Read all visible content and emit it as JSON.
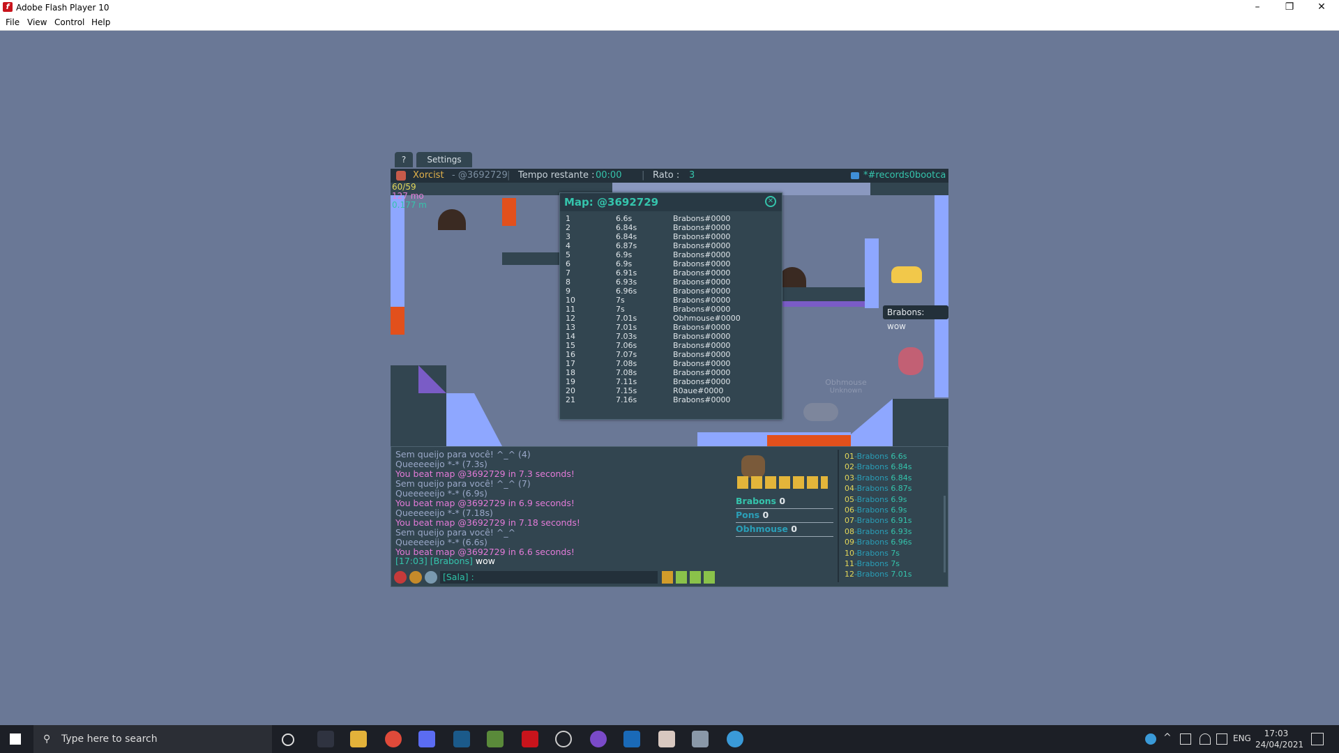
{
  "window": {
    "title": "Adobe Flash Player 10"
  },
  "menu": [
    "File",
    "View",
    "Control",
    "Help"
  ],
  "game": {
    "tabs": [
      "?",
      "Settings"
    ],
    "hud": {
      "player": "Xorcist",
      "map_code": "- @3692729",
      "time_label": "Tempo restante :",
      "time_value": "00:00",
      "rato_label": "Rato :",
      "rato_value": "3",
      "room": "*#records0bootca"
    },
    "stats": [
      "60/59",
      "127 mo",
      "0.177 m"
    ],
    "tooltip": "Brabons: wow",
    "ghost_name": "Obhmouse",
    "ghost_title": "Unknown",
    "map_window": {
      "title": "Map: @3692729",
      "records": [
        {
          "pos": "1",
          "time": "6.6s",
          "name": "Brabons#0000"
        },
        {
          "pos": "2",
          "time": "6.84s",
          "name": "Brabons#0000"
        },
        {
          "pos": "3",
          "time": "6.84s",
          "name": "Brabons#0000"
        },
        {
          "pos": "4",
          "time": "6.87s",
          "name": "Brabons#0000"
        },
        {
          "pos": "5",
          "time": "6.9s",
          "name": "Brabons#0000"
        },
        {
          "pos": "6",
          "time": "6.9s",
          "name": "Brabons#0000"
        },
        {
          "pos": "7",
          "time": "6.91s",
          "name": "Brabons#0000"
        },
        {
          "pos": "8",
          "time": "6.93s",
          "name": "Brabons#0000"
        },
        {
          "pos": "9",
          "time": "6.96s",
          "name": "Brabons#0000"
        },
        {
          "pos": "10",
          "time": "7s",
          "name": "Brabons#0000"
        },
        {
          "pos": "11",
          "time": "7s",
          "name": "Brabons#0000"
        },
        {
          "pos": "12",
          "time": "7.01s",
          "name": "Obhmouse#0000"
        },
        {
          "pos": "13",
          "time": "7.01s",
          "name": "Brabons#0000"
        },
        {
          "pos": "14",
          "time": "7.03s",
          "name": "Brabons#0000"
        },
        {
          "pos": "15",
          "time": "7.06s",
          "name": "Brabons#0000"
        },
        {
          "pos": "16",
          "time": "7.07s",
          "name": "Brabons#0000"
        },
        {
          "pos": "17",
          "time": "7.08s",
          "name": "Brabons#0000"
        },
        {
          "pos": "18",
          "time": "7.08s",
          "name": "Brabons#0000"
        },
        {
          "pos": "19",
          "time": "7.11s",
          "name": "Brabons#0000"
        },
        {
          "pos": "20",
          "time": "7.15s",
          "name": "R0aue#0000"
        },
        {
          "pos": "21",
          "time": "7.16s",
          "name": "Brabons#0000"
        }
      ]
    },
    "chat": [
      {
        "text": "Sem queijo para você! ^_^ (4)",
        "color": "#9aa8c8"
      },
      {
        "text": "Queeeeeijo *-* (7.3s)",
        "color": "#9aa8c8"
      },
      {
        "text": "You beat map @3692729 in 7.3 seconds!",
        "color": "#e37bd8"
      },
      {
        "text": "Sem queijo para você! ^_^ (7)",
        "color": "#9aa8c8"
      },
      {
        "text": "Queeeeeijo *-* (6.9s)",
        "color": "#9aa8c8"
      },
      {
        "text": "You beat map @3692729 in 6.9 seconds!",
        "color": "#e37bd8"
      },
      {
        "text": "Queeeeeijo *-* (7.18s)",
        "color": "#9aa8c8"
      },
      {
        "text": "You beat map @3692729 in 7.18 seconds!",
        "color": "#e37bd8"
      },
      {
        "text": "Sem queijo para você! ^_^",
        "color": "#9aa8c8"
      },
      {
        "text": "Queeeeeijo *-* (6.6s)",
        "color": "#9aa8c8"
      },
      {
        "text": "You beat map @3692729 in 6.6 seconds!",
        "color": "#e37bd8"
      }
    ],
    "chat_last": {
      "prefix": "[17:03] [Brabons]",
      "message": "wow"
    },
    "chat_input_prefix": "[Sala] :",
    "players": [
      {
        "name": "Brabons",
        "score": "0",
        "color": "#35c4ac"
      },
      {
        "name": "Pons",
        "score": "0",
        "color": "#2a9fb8"
      },
      {
        "name": "Obhmouse",
        "score": "0",
        "color": "#2a9fb8"
      }
    ],
    "leaderboard": [
      {
        "rank": "01",
        "name": "-Brabons",
        "time": "6.6s"
      },
      {
        "rank": "02",
        "name": "-Brabons",
        "time": "6.84s"
      },
      {
        "rank": "03",
        "name": "-Brabons",
        "time": "6.84s"
      },
      {
        "rank": "04",
        "name": "-Brabons",
        "time": "6.87s"
      },
      {
        "rank": "05",
        "name": "-Brabons",
        "time": "6.9s"
      },
      {
        "rank": "06",
        "name": "-Brabons",
        "time": "6.9s"
      },
      {
        "rank": "07",
        "name": "-Brabons",
        "time": "6.91s"
      },
      {
        "rank": "08",
        "name": "-Brabons",
        "time": "6.93s"
      },
      {
        "rank": "09",
        "name": "-Brabons",
        "time": "6.96s"
      },
      {
        "rank": "10",
        "name": "-Brabons",
        "time": "7s"
      },
      {
        "rank": "11",
        "name": "-Brabons",
        "time": "7s"
      },
      {
        "rank": "12",
        "name": "-Brabons",
        "time": "7.01s"
      }
    ],
    "colors": {
      "accent": "#35c4ac",
      "panel": "#324550",
      "bg": "#6a7896"
    }
  },
  "taskbar": {
    "search_placeholder": "Type here to search",
    "language": "ENG",
    "time": "17:03",
    "date": "24/04/2021"
  }
}
